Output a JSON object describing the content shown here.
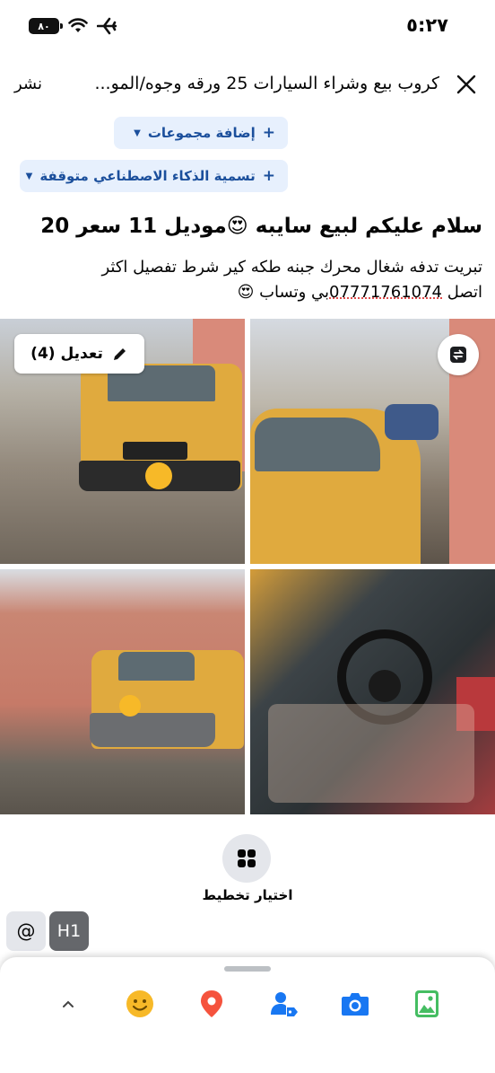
{
  "status_bar": {
    "time": "٥:٢٧",
    "battery": "٨٠",
    "icons": [
      "battery-icon",
      "wifi-icon",
      "airplane-icon"
    ]
  },
  "header": {
    "title": "كروب بيع وشراء السيارات 25 ورقه وجوه/المو...",
    "post_label": "نشر",
    "close_icon": "close-icon"
  },
  "chips": {
    "add_groups": "إضافة مجموعات",
    "ai_label": "تسمية الذكاء الاصطناعي متوقفة"
  },
  "post": {
    "title": "سلام عليكم لبيع سايبه 😍موديل 11 سعر 20",
    "body_line1": "تبريت تدفه شغال محرك جبنه طكه كير شرط تفصيل اكثر",
    "body_line2_pre": "اتصل ",
    "phone": "07771761074",
    "body_line2_post": "بي وتساب 😍"
  },
  "photos": {
    "edit_label": "تعديل (4)",
    "count": 4
  },
  "layout": {
    "label": "اختيار تخطيط"
  },
  "format": {
    "at": "@",
    "h1": "H1"
  },
  "tray": {
    "icons": [
      "chevron-up-icon",
      "emoji-icon",
      "location-icon",
      "tag-people-icon",
      "camera-icon",
      "photo-icon"
    ]
  },
  "colors": {
    "chip_bg": "#e7f0fd",
    "chip_text": "#1b4f9c",
    "emoji": "#f7b928",
    "location": "#f5533d",
    "blue": "#1877f2",
    "green": "#45bd62"
  }
}
